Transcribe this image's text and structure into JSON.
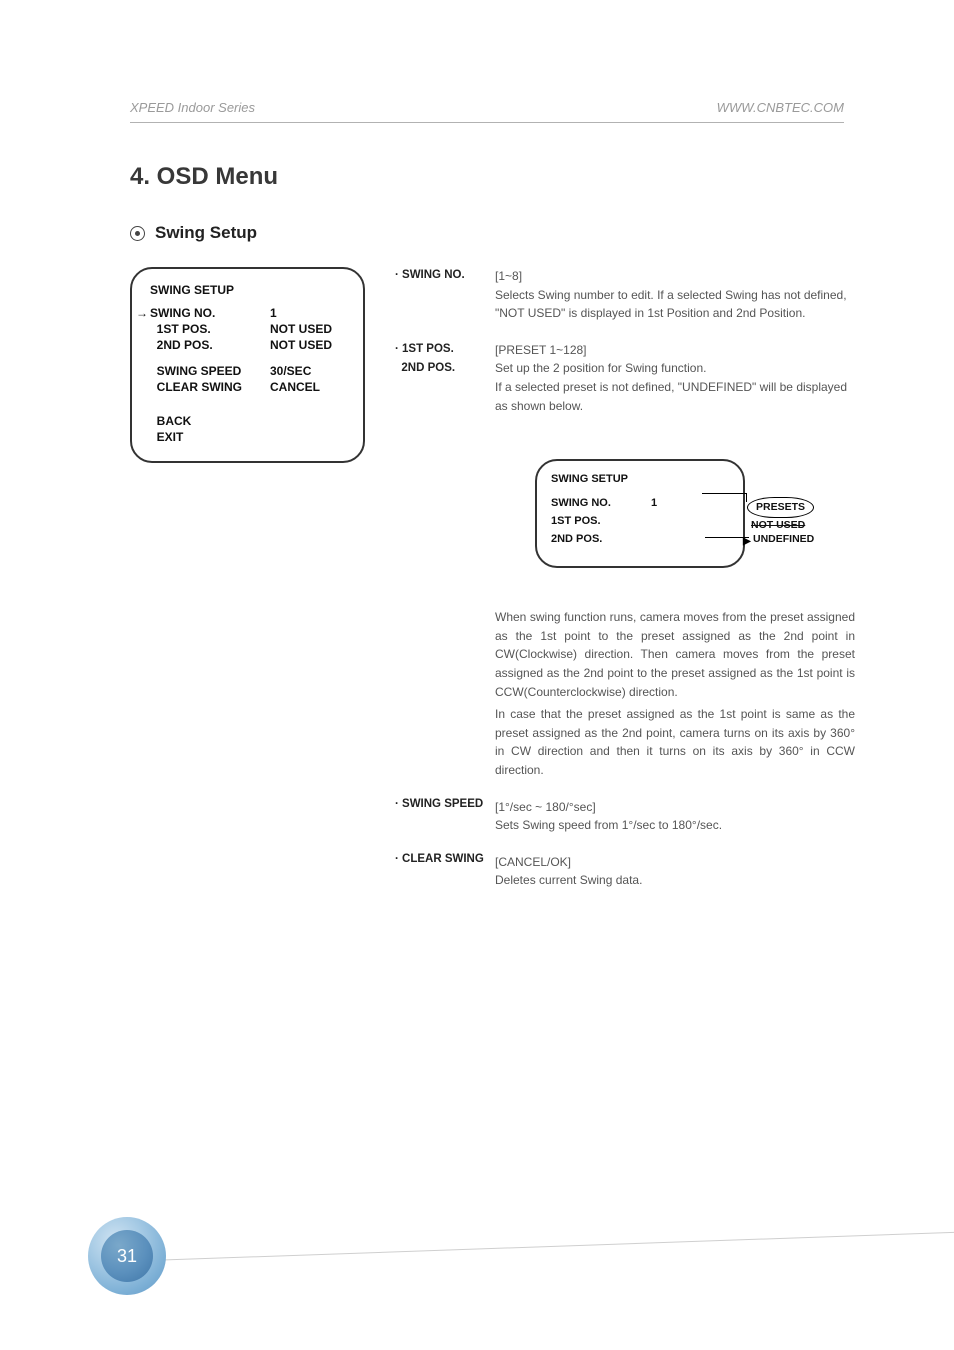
{
  "header": {
    "left": "XPEED Indoor Series",
    "right": "WWW.CNBTEC.COM"
  },
  "title": "4. OSD Menu",
  "subheading": "Swing Setup",
  "osd1": {
    "title": "SWING SETUP",
    "rows": [
      {
        "label": "SWING NO.",
        "value": "1",
        "arrow": true
      },
      {
        "label": "1ST POS.",
        "value": "NOT USED"
      },
      {
        "label": "2ND POS.",
        "value": "NOT USED"
      }
    ],
    "rows2": [
      {
        "label": "SWING SPEED",
        "value": "30/SEC"
      },
      {
        "label": "CLEAR SWING",
        "value": "CANCEL"
      }
    ],
    "rows3": [
      {
        "label": "BACK"
      },
      {
        "label": "EXIT"
      }
    ]
  },
  "items": {
    "swing_no": {
      "label": "· SWING NO.",
      "range": "[1~8]",
      "desc": "Selects Swing number to edit. If a selected Swing has not defined, \"NOT USED\" is displayed in 1st Position and 2nd Position."
    },
    "pos": {
      "label1": "· 1ST POS.",
      "label2": "  2ND POS.",
      "range": "[PRESET 1~128]",
      "desc1": "Set up the 2 position for Swing function.",
      "desc2": "If a selected preset is not defined, \"UNDEFINED\" will be displayed as shown below."
    },
    "diagram": {
      "title": "SWING SETUP",
      "r1l": "SWING NO.",
      "r1v": "1",
      "r2l": "1ST POS.",
      "r3l": "2ND POS.",
      "presets": "PRESETS",
      "notused": "NOT USED",
      "undefined": "UNDEFINED"
    },
    "pos_para1": "When swing function runs, camera moves from the preset assigned as the 1st point to the preset assigned as the 2nd point in CW(Clockwise) direction. Then camera moves from the preset assigned as the 2nd point to the preset assigned as the 1st point is CCW(Counterclockwise) direction.",
    "pos_para2": "In case that the preset assigned as the 1st point is same as the preset assigned as the 2nd point, camera turns on its axis by 360° in CW direction and then it turns on its axis by 360° in CCW direction.",
    "swing_speed": {
      "label": "· SWING SPEED",
      "range": "[1°/sec ~ 180/°sec]",
      "desc": "Sets Swing speed from 1°/sec to 180°/sec."
    },
    "clear_swing": {
      "label": "· CLEAR SWING",
      "range": "[CANCEL/OK]",
      "desc": "Deletes current Swing data."
    }
  },
  "page_number": "31"
}
